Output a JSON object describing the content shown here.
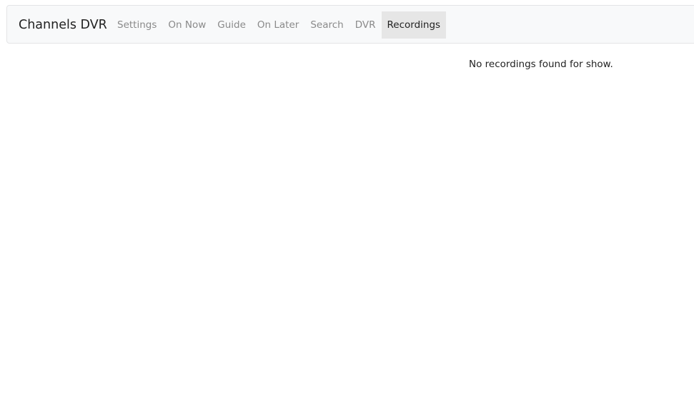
{
  "navbar": {
    "brand": "Channels DVR",
    "items": [
      {
        "label": "Settings",
        "active": false
      },
      {
        "label": "On Now",
        "active": false
      },
      {
        "label": "Guide",
        "active": false
      },
      {
        "label": "On Later",
        "active": false
      },
      {
        "label": "Search",
        "active": false
      },
      {
        "label": "DVR",
        "active": false
      },
      {
        "label": "Recordings",
        "active": true
      }
    ]
  },
  "main": {
    "empty_message": "No recordings found for show."
  },
  "colors": {
    "navbar_bg": "#f8f9fa",
    "active_tab_bg": "#e6e6e6",
    "inactive_link": "#8a8a8a",
    "text": "#222222"
  }
}
